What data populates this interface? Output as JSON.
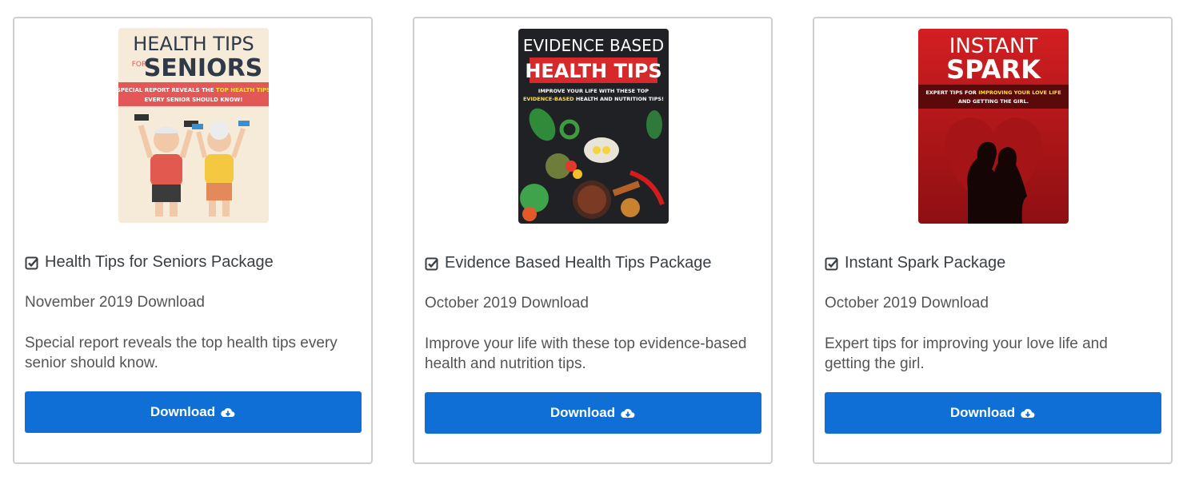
{
  "cards": [
    {
      "cover": {
        "line1": "HEALTH TIPS",
        "line2_small": "FOR",
        "line2": "SENIORS",
        "banner_a": "SPECIAL REPORT REVEALS THE ",
        "banner_hl": "TOP HEALTH TIPS",
        "banner_b": " EVERY SENIOR SHOULD KNOW!",
        "bg": "#f6ead8",
        "band": "#e45757"
      },
      "title": "Health Tips for Seniors Package",
      "date": "November 2019 Download",
      "description": "Special report reveals the top health tips every senior should know.",
      "button": "Download"
    },
    {
      "cover": {
        "line1": "EVIDENCE BASED",
        "line2": "HEALTH TIPS",
        "sub_a": "IMPROVE YOUR LIFE WITH THESE TOP",
        "sub_hl": "EVIDENCE-BASED",
        "sub_b": " HEALTH AND NUTRITION TIPS!",
        "bg": "#1f2124",
        "band": "#d7282b"
      },
      "title": "Evidence Based Health Tips Package",
      "date": "October 2019 Download",
      "description": "Improve your life with these top evidence-based health and nutrition tips.",
      "button": "Download"
    },
    {
      "cover": {
        "line1": "INSTANT",
        "line2": "SPARK",
        "sub_a": "EXPERT TIPS FOR ",
        "sub_hl": "IMPROVING YOUR LOVE LIFE",
        "sub_b": " AND GETTING THE GIRL.",
        "bg": "#b51619",
        "band": "#5a0a0b"
      },
      "title": "Instant Spark Package",
      "date": "October 2019 Download",
      "description": "Expert tips for improving your love life and getting the girl.",
      "button": "Download"
    }
  ],
  "colors": {
    "button": "#0f6fd6",
    "card_border": "#cfcfcf",
    "highlight_yellow": "#ffe13a"
  },
  "icons": {
    "title": "check-square-icon",
    "button": "cloud-download-icon"
  }
}
